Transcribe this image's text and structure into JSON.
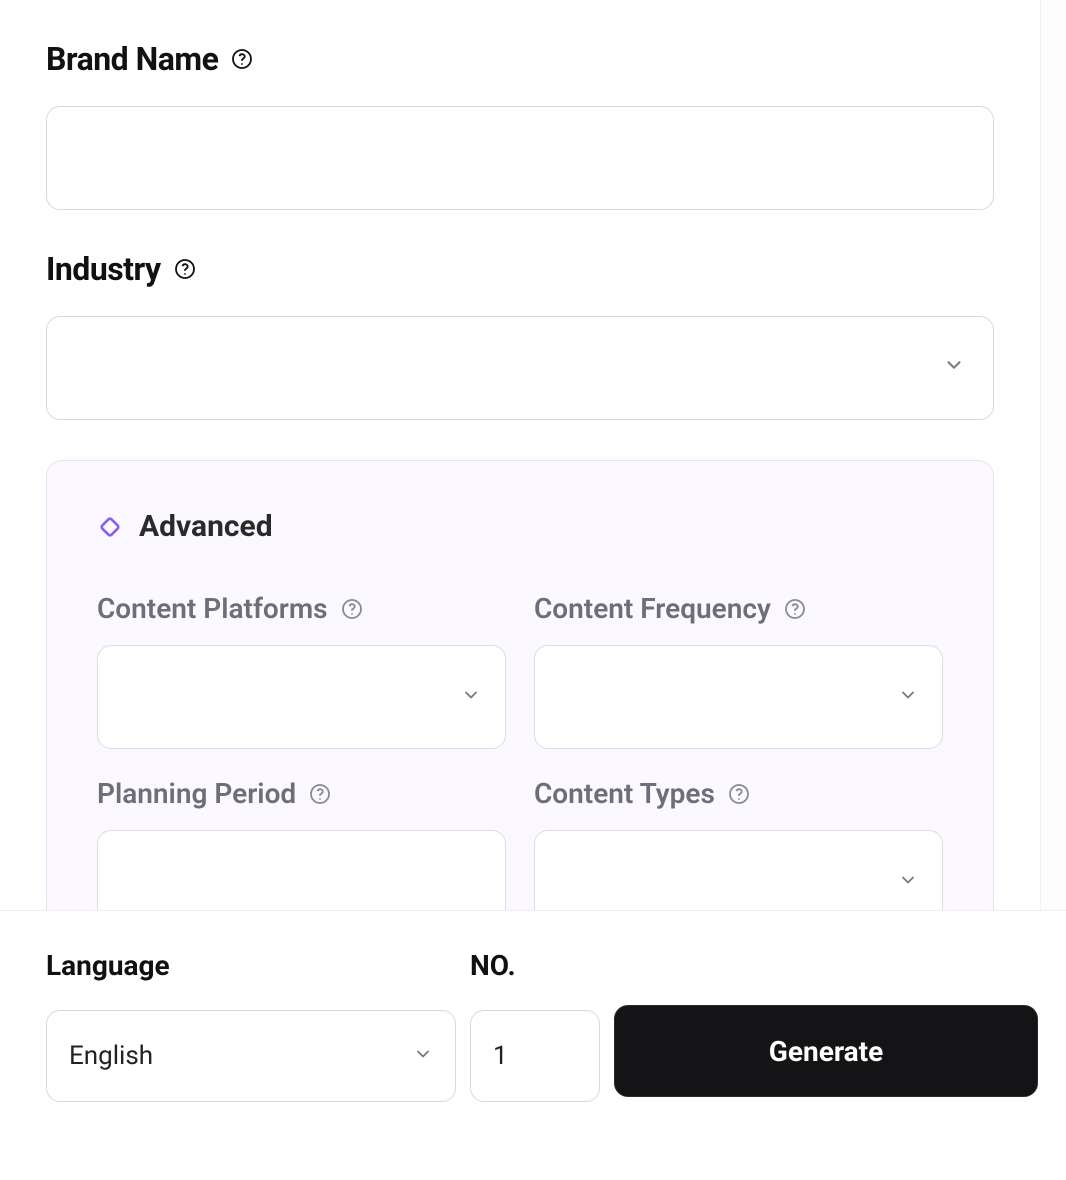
{
  "fields": {
    "brand_name": {
      "label": "Brand Name",
      "value": ""
    },
    "industry": {
      "label": "Industry",
      "value": ""
    }
  },
  "advanced": {
    "title": "Advanced",
    "content_platforms": {
      "label": "Content Platforms",
      "value": ""
    },
    "content_frequency": {
      "label": "Content Frequency",
      "value": ""
    },
    "planning_period": {
      "label": "Planning Period",
      "value": ""
    },
    "content_types": {
      "label": "Content Types",
      "value": ""
    }
  },
  "footer": {
    "language": {
      "label": "Language",
      "value": "English"
    },
    "number": {
      "label": "NO.",
      "value": "1"
    },
    "generate_label": "Generate"
  },
  "icons": {
    "help": "help-circle",
    "chevron": "chevron-down",
    "diamond": "diamond"
  }
}
